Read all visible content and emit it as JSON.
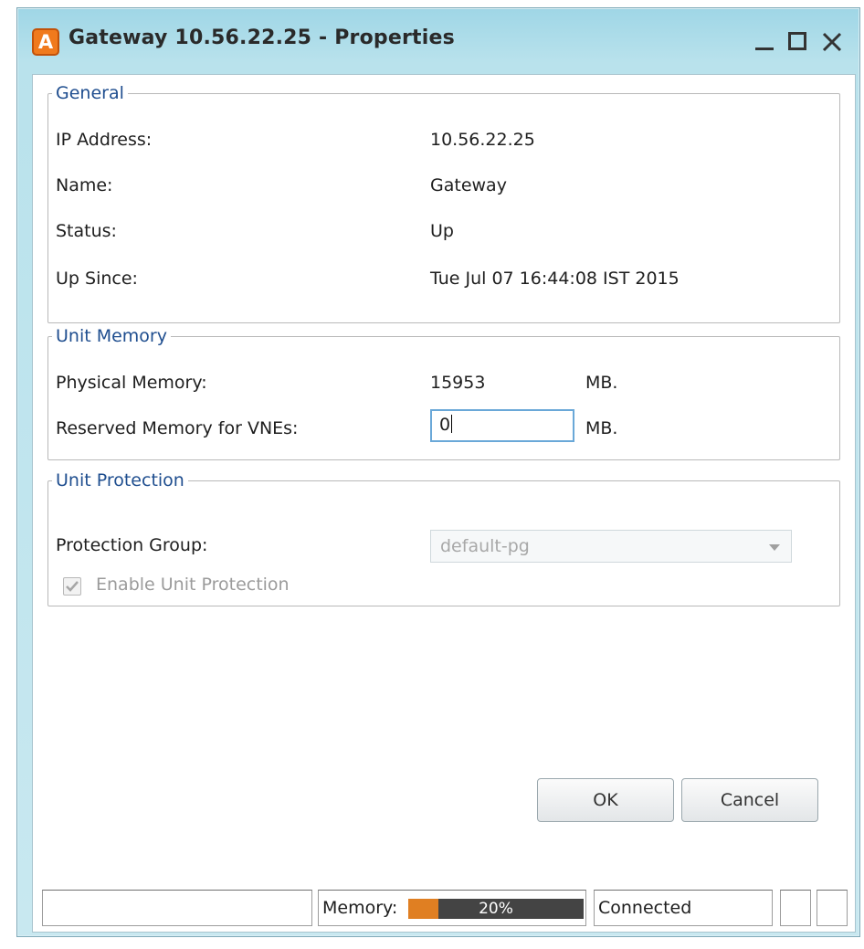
{
  "window": {
    "icon_letter": "A",
    "title": "Gateway 10.56.22.25 - Properties"
  },
  "general": {
    "legend": "General",
    "fields": [
      {
        "label": "IP Address:",
        "value": "10.56.22.25"
      },
      {
        "label": "Name:",
        "value": "Gateway"
      },
      {
        "label": "Status:",
        "value": "Up"
      },
      {
        "label": "Up Since:",
        "value": "Tue Jul 07 16:44:08 IST 2015"
      }
    ]
  },
  "unit_memory": {
    "legend": "Unit Memory",
    "physical_label": "Physical Memory:",
    "physical_value": "15953",
    "physical_unit": "MB.",
    "reserved_label": "Reserved Memory for VNEs:",
    "reserved_value": "0",
    "reserved_unit": "MB."
  },
  "unit_protection": {
    "legend": "Unit Protection",
    "group_label": "Protection Group:",
    "group_value": "default-pg",
    "enable_label": "Enable Unit Protection",
    "enable_checked": true
  },
  "buttons": {
    "ok": "OK",
    "cancel": "Cancel"
  },
  "status_bar": {
    "memory_label": "Memory:",
    "memory_percent": 20,
    "memory_text": "20%",
    "connection": "Connected"
  },
  "colors": {
    "accent_orange": "#e07f22",
    "legend_blue": "#1f4e8f",
    "titlebar": "#9fd6e6"
  }
}
